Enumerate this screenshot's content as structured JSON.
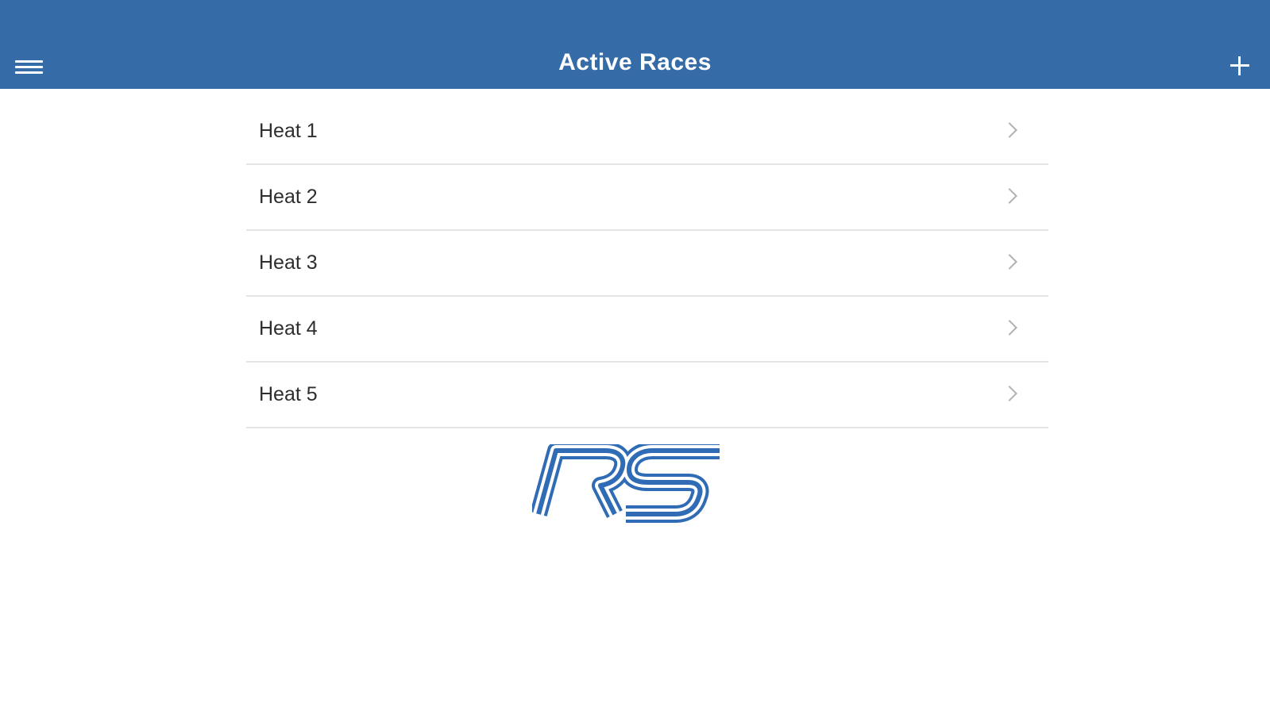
{
  "header": {
    "title": "Active Races",
    "menu_icon": "hamburger-menu-icon",
    "add_icon": "plus-icon",
    "background_color": "#356ca8"
  },
  "races": [
    {
      "label": "Heat 1"
    },
    {
      "label": "Heat 2"
    },
    {
      "label": "Heat 3"
    },
    {
      "label": "Heat 4"
    },
    {
      "label": "Heat 5"
    }
  ],
  "logo": {
    "text": "RS",
    "color": "#2f6cb5"
  }
}
